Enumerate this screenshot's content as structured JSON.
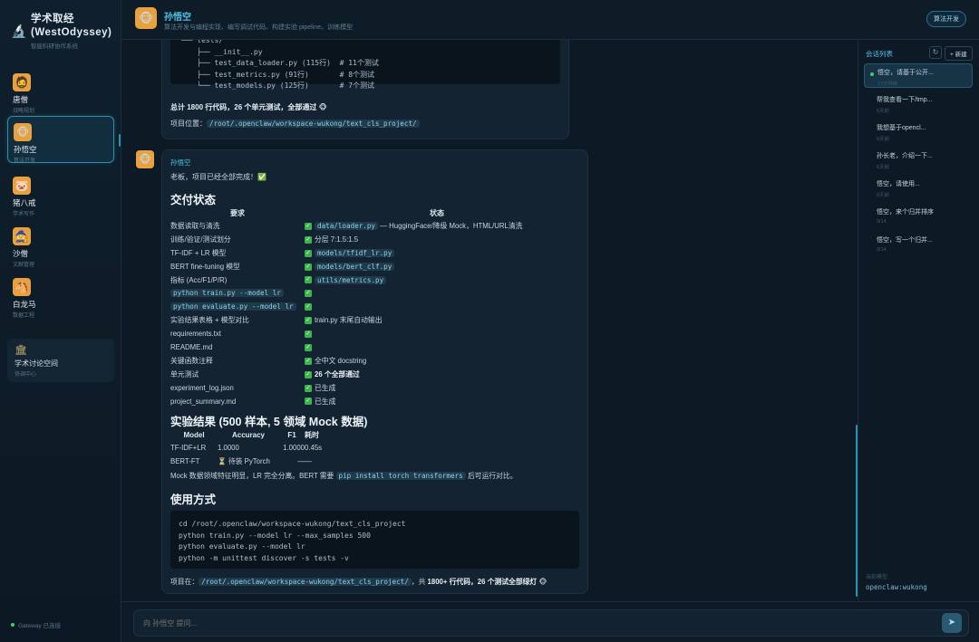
{
  "brand": {
    "title": "学术取经 (WestOdyssey)",
    "subtitle": "智能科研协作系统"
  },
  "agents": [
    {
      "name": "唐僧",
      "role": "战略规划",
      "emoji": "🧔"
    },
    {
      "name": "孙悟空",
      "role": "算法开发",
      "emoji": "🐵"
    },
    {
      "name": "猪八戒",
      "role": "学术写作",
      "emoji": "🐷"
    },
    {
      "name": "沙僧",
      "role": "文献管理",
      "emoji": "🧙"
    },
    {
      "name": "白龙马",
      "role": "数据工程",
      "emoji": "🐴"
    }
  ],
  "forum": {
    "name": "学术讨论空间",
    "subtitle": "协调中心"
  },
  "gateway": "Gateway 已连接",
  "header": {
    "name": "孙悟空",
    "subtitle": "算法开发与编程实现、编写调试代码、构建实验 pipeline、训练模型",
    "badge": "算法开发"
  },
  "msg1": {
    "tree": "└── tests/\n    ├── __init__.py\n    ├── test_data_loader.py (115行)  # 11个测试\n    ├── test_metrics.py (91行)       # 8个测试\n    └── test_models.py (125行)       # 7个测试",
    "summary": "总计 1800 行代码，26 个单元测试，全部通过 🐵",
    "location_label": "项目位置：",
    "location": "/root/.openclaw/workspace-wukong/text_cls_project/"
  },
  "msg2": {
    "sender": "孙悟空",
    "intro": "老板，项目已经全部完成！✅",
    "delivery_title": "交付状态",
    "col_req": "要求",
    "col_status": "状态",
    "rows": [
      {
        "req": "数据读取与清洗",
        "req_code": false,
        "code": "data/loader.py",
        "status": " — HuggingFace/降级 Mock，HTML/URL清洗"
      },
      {
        "req": "训练/验证/测试划分",
        "req_code": false,
        "code": "",
        "status": "分层 7:1.5:1.5"
      },
      {
        "req": "TF-IDF + LR 模型",
        "req_code": false,
        "code": "models/tfidf_lr.py",
        "status": ""
      },
      {
        "req": "BERT fine-tuning 模型",
        "req_code": false,
        "code": "models/bert_clf.py",
        "status": ""
      },
      {
        "req": "指标 (Acc/F1/P/R)",
        "req_code": false,
        "code": "utils/metrics.py",
        "status": ""
      },
      {
        "req": "python train.py --model lr",
        "req_code": true,
        "code": "",
        "status": ""
      },
      {
        "req": "python evaluate.py --model lr",
        "req_code": true,
        "code": "",
        "status": ""
      },
      {
        "req": "实验结果表格 + 模型对比",
        "req_code": false,
        "code": "",
        "status": "train.py 末尾自动输出"
      },
      {
        "req": "requirements.txt",
        "req_code": false,
        "code": "",
        "status": ""
      },
      {
        "req": "README.md",
        "req_code": false,
        "code": "",
        "status": ""
      },
      {
        "req": "关键函数注释",
        "req_code": false,
        "code": "",
        "status": "全中文 docstring"
      },
      {
        "req": "单元测试",
        "req_code": false,
        "code": "",
        "status": "26 个全部通过",
        "bold": true
      },
      {
        "req": "experiment_log.json",
        "req_code": false,
        "code": "",
        "status": "已生成"
      },
      {
        "req": "project_summary.md",
        "req_code": false,
        "code": "",
        "status": "已生成"
      }
    ],
    "results_title": "实验结果 (500 样本, 5 领域 Mock 数据)",
    "results_headers": [
      "Model",
      "Accuracy",
      "F1",
      "耗时"
    ],
    "results_rows": [
      [
        "TF-IDF+LR",
        "1.0000",
        "1.0000",
        "0.45s"
      ],
      [
        "BERT-FT",
        "⏳ 待装 PyTorch",
        "—",
        "—"
      ]
    ],
    "results_note_a": "Mock 数据领域特征明显，LR 完全分离。BERT 需要",
    "results_note_code": "pip install torch transformers",
    "results_note_b": "后可运行对比。",
    "usage_title": "使用方式",
    "usage_code": "cd /root/.openclaw/workspace-wukong/text_cls_project\npython train.py --model lr --max_samples 500\npython evaluate.py --model lr\npython -m unittest discover -s tests -v",
    "footer_a": "项目在：",
    "footer_code": "/root/.openclaw/workspace-wukong/text_cls_project/",
    "footer_b": "，共",
    "footer_bold": "1800+ 行代码，26 个测试全部绿灯",
    "footer_c": " 🐵"
  },
  "rpanel": {
    "title": "会话列表",
    "refresh": "↻",
    "new_btn": "+ 新建",
    "sessions": [
      {
        "title": "悟空，请基于公开...",
        "time": "17分钟前"
      },
      {
        "title": "帮我查看一下/tmp...",
        "time": "5天前"
      },
      {
        "title": "我想基于opencl...",
        "time": "6天前"
      },
      {
        "title": "孙长老，介绍一下...",
        "time": "6天前"
      },
      {
        "title": "悟空，请使用...",
        "time": "6天前"
      },
      {
        "title": "悟空，来个归并排序",
        "time": "3/14"
      },
      {
        "title": "悟空，写一个归并...",
        "time": "3/14"
      }
    ],
    "model_label": "当前模型",
    "model": "openclaw:wukong"
  },
  "input": {
    "placeholder": "向 孙悟空 提问...",
    "send": "➤"
  }
}
